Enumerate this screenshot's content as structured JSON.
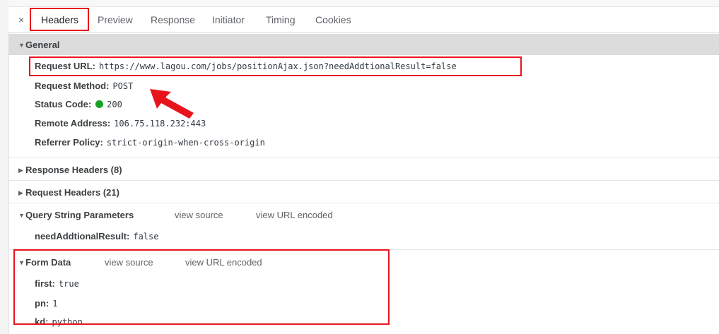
{
  "tabs": {
    "close": "×",
    "items": [
      "Headers",
      "Preview",
      "Response",
      "Initiator",
      "Timing",
      "Cookies"
    ],
    "active": "Headers"
  },
  "general": {
    "title": "General",
    "request_url_label": "Request URL:",
    "request_url": "https://www.lagou.com/jobs/positionAjax.json?needAddtionalResult=false",
    "request_method_label": "Request Method:",
    "request_method": "POST",
    "status_code_label": "Status Code:",
    "status_code": "200",
    "remote_address_label": "Remote Address:",
    "remote_address": "106.75.118.232:443",
    "referrer_policy_label": "Referrer Policy:",
    "referrer_policy": "strict-origin-when-cross-origin"
  },
  "response_headers": {
    "title": "Response Headers (8)"
  },
  "request_headers": {
    "title": "Request Headers (21)"
  },
  "query_string": {
    "title": "Query String Parameters",
    "view_source": "view source",
    "view_url_encoded": "view URL encoded",
    "params": [
      {
        "key": "needAddtionalResult:",
        "value": "false"
      }
    ]
  },
  "form_data": {
    "title": "Form Data",
    "view_source": "view source",
    "view_url_encoded": "view URL encoded",
    "fields": [
      {
        "key": "first:",
        "value": "true"
      },
      {
        "key": "pn:",
        "value": "1"
      },
      {
        "key": "kd:",
        "value": "python"
      }
    ]
  },
  "colors": {
    "highlight": "#e8141c",
    "status_ok": "#16a226",
    "section_bar": "#dcdcdc"
  },
  "icons": {
    "expanded": "triangle-down-icon",
    "collapsed": "triangle-right-icon",
    "close": "close-icon",
    "status": "green-dot-icon",
    "annotation": "red-arrow-icon"
  }
}
